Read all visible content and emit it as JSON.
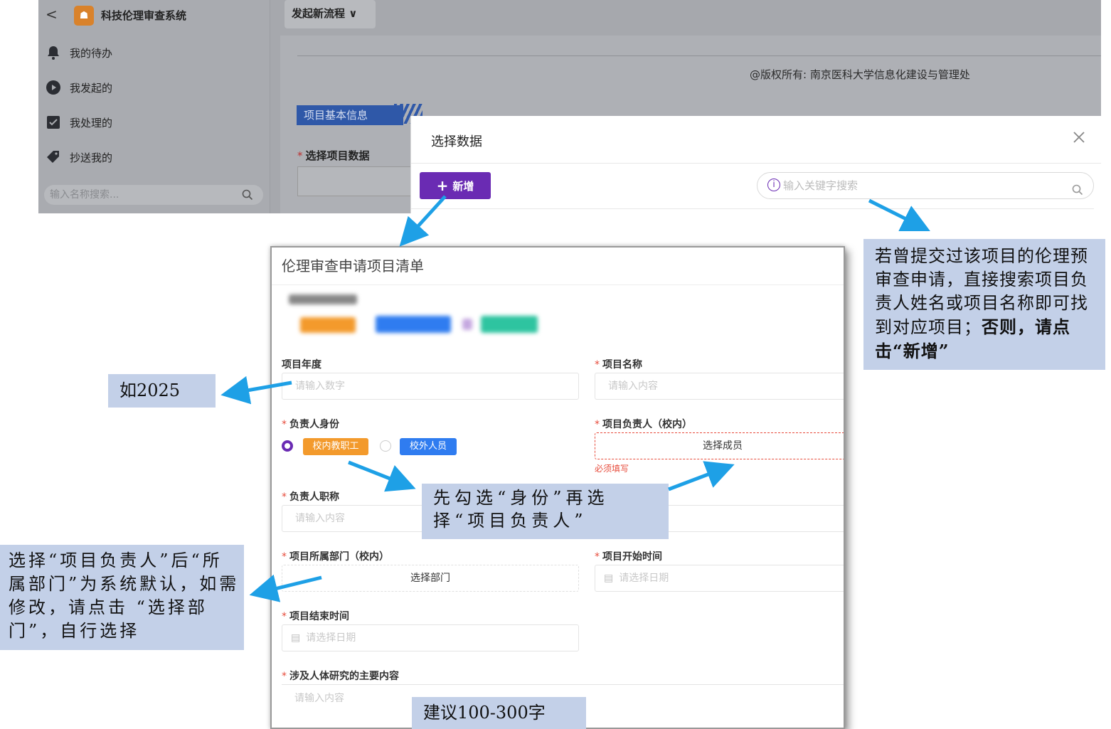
{
  "app": {
    "sidebar": {
      "title": "科技伦理审查系统",
      "logo_glyph": "☗",
      "items": [
        {
          "label": "我的待办",
          "icon": "bell-icon"
        },
        {
          "label": "我发起的",
          "icon": "play-circle-icon"
        },
        {
          "label": "我处理的",
          "icon": "checkbox-icon"
        },
        {
          "label": "抄送我的",
          "icon": "tag-icon"
        }
      ],
      "search_placeholder": "输入名称搜索..."
    },
    "header": {
      "start_process": "发起新流程 ∨"
    },
    "main": {
      "copyright": "@版权所有: 南京医科大学信息化建设与管理处",
      "section_tab": "项目基本信息",
      "select_label": "选择项目数据"
    },
    "dialog": {
      "title": "选择数据",
      "add_button": "新增",
      "search_placeholder": "输入关键字搜索"
    }
  },
  "form": {
    "title": "伦理审查申请项目清单",
    "fields": {
      "year": {
        "label": "项目年度",
        "placeholder": "请输入数字"
      },
      "name": {
        "label": "项目名称",
        "placeholder": "请输入内容"
      },
      "identity": {
        "label": "负责人身份",
        "option_internal": "校内教职工",
        "option_external": "校外人员"
      },
      "leader": {
        "label": "项目负责人（校内）",
        "button": "选择成员",
        "error": "必须填写"
      },
      "title_rank": {
        "label": "负责人职称",
        "placeholder": "请输入内容"
      },
      "department": {
        "label": "项目所属部门（校内）",
        "button": "选择部门"
      },
      "start": {
        "label": "项目开始时间",
        "placeholder": "请选择日期"
      },
      "end": {
        "label": "项目结束时间",
        "placeholder": "请选择日期"
      },
      "content": {
        "label": "涉及人体研究的主要内容",
        "placeholder": "请输入内容"
      }
    }
  },
  "callouts": {
    "search_hint": "若曾提交过该项目的伦理预审查申请，直接搜索项目负责人姓名或项目名称即可找到对应项目；",
    "search_hint_bold": "否则，请点击“新增”",
    "year_hint": "如2025",
    "identity_hint": "先勾选“身份”再选择“项目负责人”",
    "department_hint": "选择“项目负责人”后“所属部门”为系统默认，如需修改，请点击 “选择部门”，自行选择",
    "content_hint": "建议100-300字"
  },
  "colors": {
    "accent": "#6a2bb3",
    "callout_bg": "#c3d0e8",
    "arrow": "#1ea0e6",
    "tag_orange": "#f39a2c",
    "tag_blue": "#2f7cf0"
  }
}
